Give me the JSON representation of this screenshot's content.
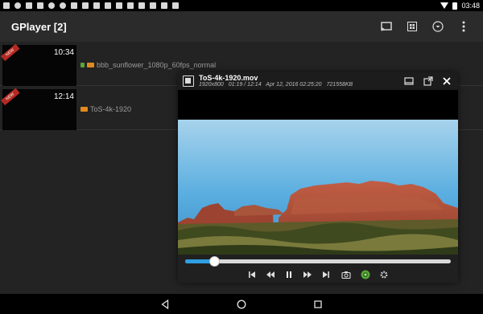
{
  "status_bar": {
    "time": "03:48",
    "icons": [
      "notification-icon",
      "warning-icon",
      "rocket-icon",
      "image-icon",
      "shield-icon",
      "shield-icon",
      "phone-icon",
      "bag-icon",
      "bag-icon",
      "bag-icon",
      "rocket-icon",
      "bag-icon",
      "bag-icon",
      "bag-icon",
      "bag-icon",
      "bag-icon"
    ]
  },
  "app_bar": {
    "title": "GPlayer [2]",
    "actions": [
      "cast-icon",
      "grid-icon",
      "filter-icon",
      "more-icon"
    ]
  },
  "list": {
    "items": [
      {
        "duration": "10:34",
        "name": "bbb_sunflower_1080p_60fps_normal",
        "ribbon": "NEW"
      },
      {
        "duration": "12:14",
        "name": "ToS-4k-1920",
        "ribbon": "NEW"
      }
    ]
  },
  "player": {
    "title": "ToS-4k-1920.mov",
    "resolution": "1920x800",
    "position": "01:19 / 12:14",
    "date": "Apr 12, 2016 02:25:20",
    "size": "721558KB",
    "progress": 0.11,
    "colors": {
      "progress": "#2f9ee0",
      "sky_top": "#8fc6e6",
      "sky_bottom": "#4a9fd3",
      "rock": "#b5533c"
    }
  },
  "nav_bar": {
    "buttons": [
      "back-icon",
      "home-icon",
      "recents-icon"
    ]
  }
}
